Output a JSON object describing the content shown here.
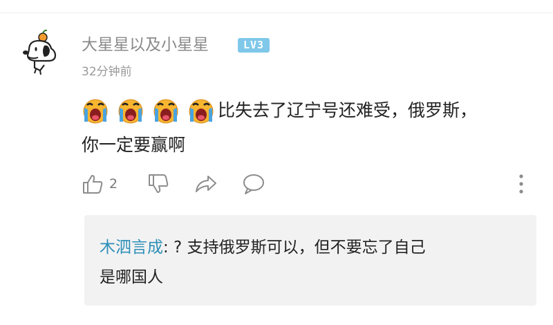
{
  "comment": {
    "username": "大星星以及小星星",
    "level_badge": "LV3",
    "timestamp": "32分钟前",
    "emoji_icons": [
      "crying-face-icon",
      "crying-face-icon",
      "crying-face-icon",
      "crying-face-icon"
    ],
    "text_line1": "比失去了辽宁号还难受，俄罗斯，",
    "text_line2": "你一定要赢啊",
    "like_count": "2"
  },
  "reply": {
    "author": "木泗言成",
    "text_line1": ": ? 支持俄罗斯可以，但不要忘了自己",
    "text_line2": "是哪国人"
  },
  "icons": {
    "like": "thumbs-up-icon",
    "dislike": "thumbs-down-icon",
    "share": "share-arrow-icon",
    "reply": "speech-bubble-icon",
    "more": "vertical-dots-icon"
  },
  "colors": {
    "username": "#8a8a8a",
    "level_badge": "#7fc8ea",
    "reply_author": "#2c8fb8",
    "reply_background": "#f2f2f2",
    "icon_gray": "#8c8c8c"
  }
}
